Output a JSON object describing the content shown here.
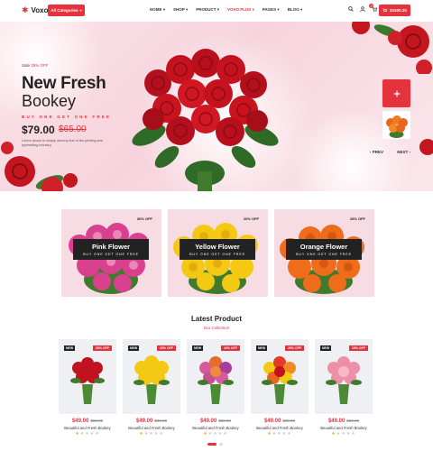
{
  "header": {
    "logo": "Voxo",
    "category_btn": "All Categories",
    "nav": [
      "HOME",
      "SHOP",
      "PRODUCT",
      "VOXO PLUS",
      "PAGES",
      "BLOG"
    ],
    "cart_count": "2",
    "cart_total": "$1500.25"
  },
  "hero": {
    "sale_prefix": "Sale",
    "sale_pct": "35% OFF",
    "title1": "New Fresh",
    "title2": "Bookey",
    "offer": "BUY ONE GET ONE FREE",
    "price": "$79.00",
    "old_price": "$65.00",
    "desc": "Lorem Ipsum is simply dummy text of the printing and typesetting industry.",
    "prev": "PREV",
    "next": "NEXT"
  },
  "banners": [
    {
      "title": "Pink Flower",
      "sub": "BUY ONE GET ONE FREE",
      "off": "30% OFF"
    },
    {
      "title": "Yellow Flower",
      "sub": "BUY ONE GET ONE FREE",
      "off": "20% OFF"
    },
    {
      "title": "Orange Flower",
      "sub": "BUY ONE GET ONE FREE",
      "off": "25% OFF"
    }
  ],
  "latest": {
    "title": "Latest Product",
    "subtitle": "Our Collection"
  },
  "products": [
    {
      "badge": "NEW",
      "pct": "30% OFF",
      "price": "$49.00",
      "old": "$80.00",
      "name": "Beautiful and Fresh Bookey",
      "rating": 1
    },
    {
      "badge": "NEW",
      "pct": "20% OFF",
      "price": "$49.00",
      "old": "$80.00",
      "name": "Beautiful and Fresh Bookey",
      "rating": 1
    },
    {
      "badge": "NEW",
      "pct": "10% OFF",
      "price": "$49.00",
      "old": "$80.00",
      "name": "Beautiful and Fresh Bookey",
      "rating": 1
    },
    {
      "badge": "NEW",
      "pct": "20% OFF",
      "price": "$49.00",
      "old": "$80.00",
      "name": "Beautiful and Fresh Bookey",
      "rating": 1
    },
    {
      "badge": "NEW",
      "pct": "10% OFF",
      "price": "$49.00",
      "old": "$80.00",
      "name": "Beautiful and Fresh Bookey",
      "rating": 1
    }
  ],
  "colors": {
    "accent": "#e6323c",
    "dark": "#222222"
  },
  "icons": [
    "search-icon",
    "user-icon",
    "cart-icon",
    "chevron-down-icon",
    "close-icon"
  ]
}
